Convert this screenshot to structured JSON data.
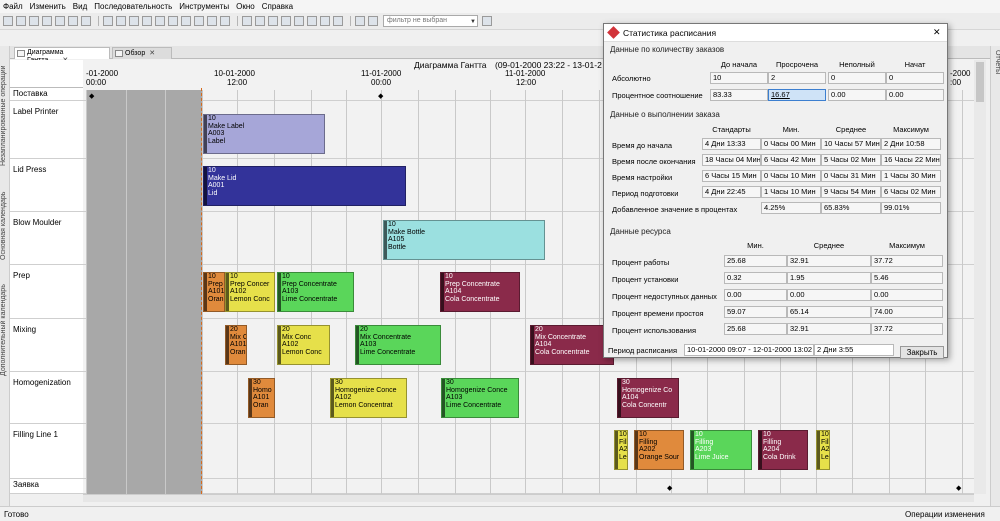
{
  "menu": [
    "Файл",
    "Изменить",
    "Вид",
    "Последовательность",
    "Инструменты",
    "Окно",
    "Справка"
  ],
  "toolbar": {
    "filter_placeholder": "фильтр не выбран"
  },
  "side_tabs": {
    "left": [
      "Незапланированные операции",
      "Основная календарь",
      "Дополнительный календарь"
    ],
    "right": [
      "Отчеты"
    ]
  },
  "tabs": [
    {
      "label": "Диаграмма Гантта",
      "close": "✕"
    },
    {
      "label": "Обзор",
      "close": "✕"
    }
  ],
  "gantt": {
    "title": "Диаграмма Гантта",
    "range": "(09-01-2000 23:22 - 13-01-2",
    "dates": [
      {
        "date": "-01-2000",
        "time": "00:00"
      },
      {
        "date": "10-01-2000",
        "time": "12:00"
      },
      {
        "date": "11-01-2000",
        "time": "00:00"
      },
      {
        "date": "11-01-2000",
        "time": "12:00"
      },
      {
        "date": "-2000",
        "time": ":00"
      }
    ],
    "resources": [
      "Поставка",
      "Label Printer",
      "Lid Press",
      "Blow Moulder",
      "Prep",
      "Mixing",
      "Homogenization",
      "Filling Line 1",
      "Заявка"
    ],
    "bars": [
      {
        "res": 1,
        "lines": [
          "10",
          "Make Label",
          "A003",
          "Label"
        ],
        "color": "#a6a6d8",
        "tc": "#000"
      },
      {
        "res": 2,
        "lines": [
          "10",
          "Make Lid",
          "A001",
          "Lid"
        ],
        "color": "#33339a",
        "tc": "#fff"
      },
      {
        "res": 3,
        "lines": [
          "10",
          "Make Bottle",
          "A105",
          "Bottle"
        ],
        "color": "#9be0e0",
        "tc": "#000"
      },
      {
        "res": 4,
        "lines": [
          "10",
          "Prep",
          "A101",
          "Oran"
        ],
        "color": "#e08a3c",
        "tc": "#000"
      },
      {
        "res": 4,
        "lines": [
          "10",
          "Prep Concer",
          "A102",
          "Lemon Conc"
        ],
        "color": "#e6e04a",
        "tc": "#000"
      },
      {
        "res": 4,
        "lines": [
          "10",
          "Prep Concentrate",
          "A103",
          "Lime Concentrate"
        ],
        "color": "#5ad65a",
        "tc": "#000"
      },
      {
        "res": 4,
        "lines": [
          "10",
          "Prep Concentrate",
          "A104",
          "Cola Concentrate"
        ],
        "color": "#8a2a4a",
        "tc": "#fff"
      },
      {
        "res": 5,
        "lines": [
          "20",
          "Mix C",
          "A101",
          "Oran"
        ],
        "color": "#e08a3c",
        "tc": "#000"
      },
      {
        "res": 5,
        "lines": [
          "20",
          "Mix Conc",
          "A102",
          "Lemon Conc"
        ],
        "color": "#e6e04a",
        "tc": "#000"
      },
      {
        "res": 5,
        "lines": [
          "20",
          "Mix Concentrate",
          "A103",
          "Lime Concentrate"
        ],
        "color": "#5ad65a",
        "tc": "#000"
      },
      {
        "res": 5,
        "lines": [
          "20",
          "Mix Concentrate",
          "A104",
          "Cola Concentrate"
        ],
        "color": "#8a2a4a",
        "tc": "#fff"
      },
      {
        "res": 6,
        "lines": [
          "30",
          "Homo",
          "A101",
          "Oran"
        ],
        "color": "#e08a3c",
        "tc": "#000"
      },
      {
        "res": 6,
        "lines": [
          "30",
          "Homogenize Conce",
          "A102",
          "Lemon Concentrat"
        ],
        "color": "#e6e04a",
        "tc": "#000"
      },
      {
        "res": 6,
        "lines": [
          "30",
          "Homogenize Conce",
          "A103",
          "Lime Concentrate"
        ],
        "color": "#5ad65a",
        "tc": "#000"
      },
      {
        "res": 6,
        "lines": [
          "30",
          "Homogenize Co",
          "A104",
          "Cola Concentr"
        ],
        "color": "#8a2a4a",
        "tc": "#fff"
      },
      {
        "res": 7,
        "lines": [
          "10",
          "Filling",
          "A2",
          "Le"
        ],
        "color": "#e6e04a",
        "tc": "#000"
      },
      {
        "res": 7,
        "lines": [
          "10",
          "Filling",
          "A202",
          "Orange Sour"
        ],
        "color": "#e08a3c",
        "tc": "#000"
      },
      {
        "res": 7,
        "lines": [
          "10",
          "Filling",
          "A203",
          "Lime Juice"
        ],
        "color": "#5ad65a",
        "tc": "#fff"
      },
      {
        "res": 7,
        "lines": [
          "10",
          "Filling",
          "A204",
          "Cola Drink"
        ],
        "color": "#8a2a4a",
        "tc": "#fff"
      },
      {
        "res": 7,
        "lines": [
          "10",
          "Filli",
          "A2",
          "Le"
        ],
        "color": "#e6e04a",
        "tc": "#000"
      }
    ]
  },
  "status": {
    "left": "Готово",
    "right": "Операции изменения"
  },
  "dialog": {
    "title": "Статистика расписания",
    "close": "✕",
    "orders": {
      "section": "Данные по количеству заказов",
      "headers": [
        "До начала",
        "Просрочена",
        "Неполный",
        "Начат"
      ],
      "rows": [
        {
          "label": "Абсолютно",
          "values": [
            "10",
            "2",
            "0",
            "0"
          ]
        },
        {
          "label": "Процентное соотношение",
          "values": [
            "83.33",
            "16.67",
            "0.00",
            "0.00"
          ]
        }
      ]
    },
    "execution": {
      "section": "Данные о выполнении заказа",
      "headers": [
        "Стандарты",
        "Мин.",
        "Среднее",
        "Максимум"
      ],
      "rows": [
        {
          "label": "Время до начала",
          "values": [
            "4 Дни 13:33",
            "0 Часы 00 Мин",
            "10 Часы 57 Мин",
            "2 Дни 10:58"
          ]
        },
        {
          "label": "Время после окончания",
          "values": [
            "18 Часы 04 Мин",
            "6 Часы 42 Мин",
            "5 Часы 02 Мин",
            "16 Часы 22 Мин"
          ]
        },
        {
          "label": "Время настройки",
          "values": [
            "6 Часы 15 Мин",
            "0 Часы 10 Мин",
            "0 Часы 31 Мин",
            "1 Часы 30 Мин"
          ]
        },
        {
          "label": "Период подготовки",
          "values": [
            "4 Дни 22:45",
            "1 Часы 10 Мин",
            "9 Часы 54 Мин",
            "6 Часы 02 Мин"
          ]
        },
        {
          "label": "Добавленное значение в процентах",
          "values": [
            "",
            "4.25%",
            "65.83%",
            "99.01%"
          ]
        }
      ]
    },
    "resource": {
      "section": "Данные ресурса",
      "headers": [
        "Мин.",
        "Среднее",
        "Максимум"
      ],
      "rows": [
        {
          "label": "Процент работы",
          "values": [
            "25.68",
            "32.91",
            "37.72"
          ]
        },
        {
          "label": "Процент установки",
          "values": [
            "0.32",
            "1.95",
            "5.46"
          ]
        },
        {
          "label": "Процент недоступных данных",
          "values": [
            "0.00",
            "0.00",
            "0.00"
          ]
        },
        {
          "label": "Процент времени простоя",
          "values": [
            "59.07",
            "65.14",
            "74.00"
          ]
        },
        {
          "label": "Процент использования",
          "values": [
            "25.68",
            "32.91",
            "37.72"
          ]
        }
      ]
    },
    "period": {
      "label": "Период расписания",
      "value": "10-01-2000 09:07 - 12-01-2000 13:02",
      "days": "2 Дни 3:55"
    },
    "close_button": "Закрыть"
  }
}
